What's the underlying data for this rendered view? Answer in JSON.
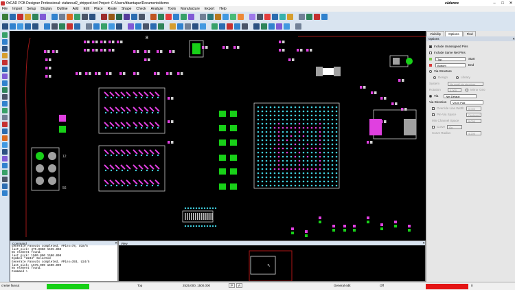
{
  "window": {
    "title": "OrCAD PCB Designer Professional: viafanout2_stripped.brd  Project: C:/Users/dbantapur/Documents/demo",
    "brand": "cādence",
    "minimize": "–",
    "maximize": "□",
    "close": "✕"
  },
  "menu": [
    "File",
    "Import",
    "Setup",
    "Display",
    "Outline",
    "Add",
    "Edit",
    "Place",
    "Route",
    "Shape",
    "Check",
    "Analyze",
    "Tools",
    "Manufacture",
    "Export",
    "Help"
  ],
  "toolbar_colors": {
    "row1": [
      "#3a7d3a",
      "#2b6cb0",
      "#c53030",
      "#d69e2e",
      "#2f855a",
      "#805ad5",
      "#3182ce",
      "#718096",
      "#dd6b20",
      "#38a169",
      "#4a5568",
      "#2c5282",
      "#9b2c2c",
      "#975a16",
      "#276749",
      "#553c9a",
      "#2b6cb0",
      "#4a5568",
      "#c05621",
      "#2f855a",
      "#e53e3e",
      "#3182ce",
      "#38a169",
      "#805ad5",
      "#718096",
      "#2c7a7b",
      "#b7791f",
      "#4299e1",
      "#48bb78",
      "#ed8936",
      "#9f7aea",
      "#4a5568",
      "#e53e3e",
      "#2b6cb0",
      "#38b2ac",
      "#d69e2e",
      "#718096",
      "#2f855a",
      "#c53030",
      "#3182ce"
    ],
    "row2": [
      "#2c5282",
      "#3182ce",
      "#4299e1",
      "#2b6cb0",
      "#2c5282",
      "#3182ce",
      "#4a5568",
      "#2f855a",
      "#c53030",
      "#2b6cb0",
      "#718096",
      "#3182ce",
      "#38a169",
      "#4299e1",
      "#2c5282",
      "#805ad5",
      "#3182ce",
      "#4a5568",
      "#2b6cb0",
      "#2f855a",
      "#d69e2e",
      "#3182ce",
      "#718096",
      "#2c5282",
      "#4299e1",
      "#38a169",
      "#2b6cb0",
      "#c53030",
      "#3182ce",
      "#4a5568",
      "#2c5282",
      "#2f855a",
      "#3182ce",
      "#805ad5",
      "#4299e1",
      "#718096"
    ],
    "left": [
      "#38a169",
      "#3182ce",
      "#2c5282",
      "#d69e2e",
      "#c53030",
      "#2b6cb0",
      "#805ad5",
      "#3182ce",
      "#2f855a",
      "#4a5568",
      "#3182ce",
      "#38a169",
      "#718096",
      "#c53030",
      "#2b6cb0",
      "#dd6b20",
      "#4299e1",
      "#2c5282",
      "#805ad5",
      "#3182ce",
      "#38a169",
      "#4a5568",
      "#2b6cb0",
      "#3182ce"
    ]
  },
  "right_panel": {
    "tabs": [
      "Visibility",
      "Options",
      "Find"
    ],
    "active_tab": "Options",
    "header": "Options",
    "include_unassigned": "Include Unassigned Pins",
    "include_same_net": "Include Same Net Pins",
    "start_layer": "Top",
    "start_label": "Start",
    "end_layer": "Bottom",
    "end_label": "End",
    "start_color": "#7ec850",
    "end_color": "#d93a3a",
    "via_structure": "Via Structure",
    "design": "Design",
    "library": "Library",
    "system_label": "System",
    "system_value": "No avail via structure",
    "rotation_label": "Rotation",
    "rotation_value": "0.000",
    "mirror_geo": "Mirror Geo",
    "via": "Via",
    "via_value": "Net Default",
    "via_direction_label": "Via Direction",
    "via_direction_value": "Via In Pad",
    "override_line_width": "Override Line Width",
    "override_value": "0.000",
    "pin_via_space": "Pin-Via Space",
    "pin_via_space_value": "Centered",
    "min_channel_space": "Min Channel Space",
    "min_channel_space_value": "5.000",
    "curve": "Curve",
    "curve_value": "On",
    "curve_radius_label": "Curve Radius",
    "curve_radius_value": "4.200"
  },
  "command": {
    "title": "Command",
    "lines": [
      "Generate Fanouts completed, #Pins=78, U18/5",
      "last pick:  475.0000 1525.000",
      "No element found.",
      "last pick:  1500.000 1500.000",
      "Symbol \"U244\" Selected",
      "Generate Fanouts completed, #Pins=393, U24/5",
      "last pick:  1575.000 1500.000",
      "No element found.",
      "Command >"
    ]
  },
  "view": {
    "title": "View"
  },
  "status": {
    "command": "create fanout",
    "layer": "Top",
    "coords": "2525.000, 1500.000",
    "p_button": "P",
    "a_button": "A",
    "mode": "General edit",
    "drc": "Off",
    "count": "0",
    "green": "#16d016",
    "red": "#e41414"
  }
}
